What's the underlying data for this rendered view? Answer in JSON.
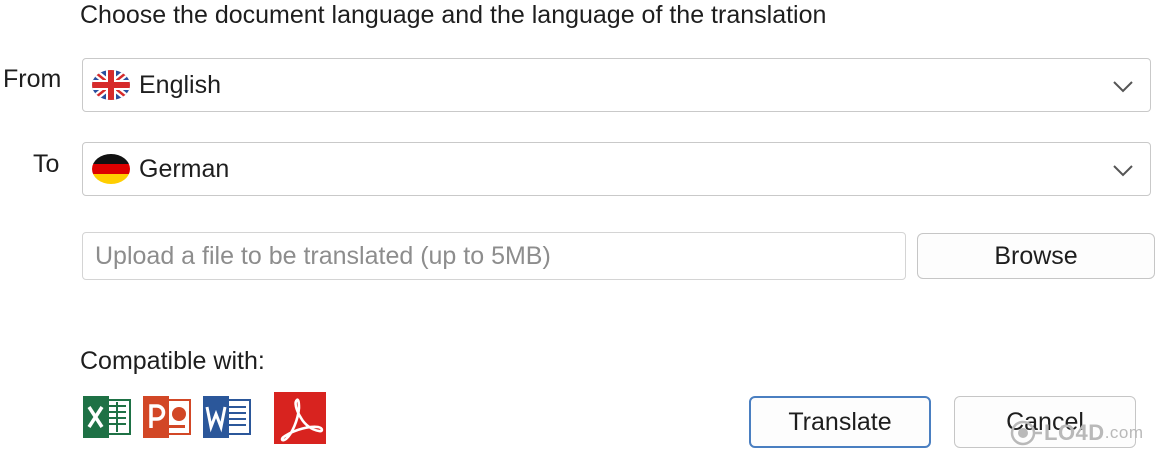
{
  "instruction": "Choose the document language and the language of the translation",
  "from": {
    "label": "From",
    "selected": "English",
    "flag": "uk-flag-icon"
  },
  "to": {
    "label": "To",
    "selected": "German",
    "flag": "germany-flag-icon"
  },
  "upload": {
    "placeholder": "Upload a file to be translated (up to 5MB)",
    "value": "",
    "browse_label": "Browse"
  },
  "compatible": {
    "label": "Compatible with:",
    "apps": [
      "excel-icon",
      "powerpoint-icon",
      "word-icon",
      "pdf-icon"
    ]
  },
  "actions": {
    "translate_label": "Translate",
    "cancel_label": "Cancel"
  },
  "watermark": {
    "brand": "LO4D",
    "domain": ".com"
  },
  "colors": {
    "accent": "#4a7fc1",
    "excel": "#1e7145",
    "powerpoint": "#d24726",
    "word": "#2b579a",
    "pdf": "#d8231f"
  }
}
